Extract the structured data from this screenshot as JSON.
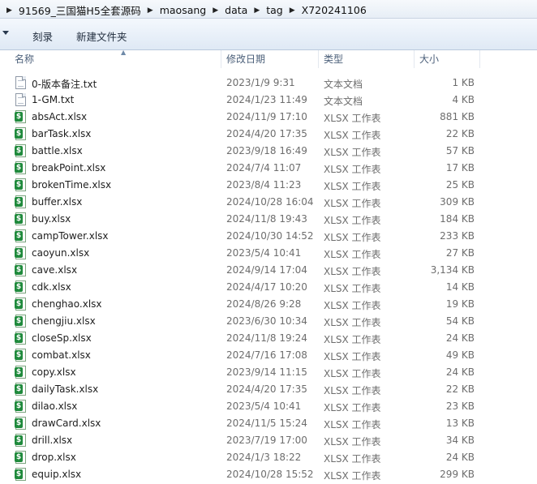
{
  "breadcrumb": [
    "91569_三国猫H5全套源码",
    "maosang",
    "data",
    "tag",
    "X720241106"
  ],
  "toolbar": {
    "burn": "刻录",
    "new_folder": "新建文件夹"
  },
  "columns": {
    "name": "名称",
    "date": "修改日期",
    "type": "类型",
    "size": "大小"
  },
  "files": [
    {
      "name": "0-版本备注.txt",
      "date": "2023/1/9 9:31",
      "type": "文本文档",
      "size": "1 KB",
      "icon": "txt"
    },
    {
      "name": "1-GM.txt",
      "date": "2024/1/23 11:49",
      "type": "文本文档",
      "size": "4 KB",
      "icon": "txt"
    },
    {
      "name": "absAct.xlsx",
      "date": "2024/11/9 17:10",
      "type": "XLSX 工作表",
      "size": "881 KB",
      "icon": "xlsx"
    },
    {
      "name": "barTask.xlsx",
      "date": "2024/4/20 17:35",
      "type": "XLSX 工作表",
      "size": "22 KB",
      "icon": "xlsx"
    },
    {
      "name": "battle.xlsx",
      "date": "2023/9/18 16:49",
      "type": "XLSX 工作表",
      "size": "57 KB",
      "icon": "xlsx"
    },
    {
      "name": "breakPoint.xlsx",
      "date": "2024/7/4 11:07",
      "type": "XLSX 工作表",
      "size": "17 KB",
      "icon": "xlsx"
    },
    {
      "name": "brokenTime.xlsx",
      "date": "2023/8/4 11:23",
      "type": "XLSX 工作表",
      "size": "25 KB",
      "icon": "xlsx"
    },
    {
      "name": "buffer.xlsx",
      "date": "2024/10/28 16:04",
      "type": "XLSX 工作表",
      "size": "309 KB",
      "icon": "xlsx"
    },
    {
      "name": "buy.xlsx",
      "date": "2024/11/8 19:43",
      "type": "XLSX 工作表",
      "size": "184 KB",
      "icon": "xlsx"
    },
    {
      "name": "campTower.xlsx",
      "date": "2024/10/30 14:52",
      "type": "XLSX 工作表",
      "size": "233 KB",
      "icon": "xlsx"
    },
    {
      "name": "caoyun.xlsx",
      "date": "2023/5/4 10:41",
      "type": "XLSX 工作表",
      "size": "27 KB",
      "icon": "xlsx"
    },
    {
      "name": "cave.xlsx",
      "date": "2024/9/14 17:04",
      "type": "XLSX 工作表",
      "size": "3,134 KB",
      "icon": "xlsx"
    },
    {
      "name": "cdk.xlsx",
      "date": "2024/4/17 10:20",
      "type": "XLSX 工作表",
      "size": "14 KB",
      "icon": "xlsx"
    },
    {
      "name": "chenghao.xlsx",
      "date": "2024/8/26 9:28",
      "type": "XLSX 工作表",
      "size": "19 KB",
      "icon": "xlsx"
    },
    {
      "name": "chengjiu.xlsx",
      "date": "2023/6/30 10:34",
      "type": "XLSX 工作表",
      "size": "54 KB",
      "icon": "xlsx"
    },
    {
      "name": "closeSp.xlsx",
      "date": "2024/11/8 19:24",
      "type": "XLSX 工作表",
      "size": "24 KB",
      "icon": "xlsx"
    },
    {
      "name": "combat.xlsx",
      "date": "2024/7/16 17:08",
      "type": "XLSX 工作表",
      "size": "49 KB",
      "icon": "xlsx"
    },
    {
      "name": "copy.xlsx",
      "date": "2023/9/14 11:15",
      "type": "XLSX 工作表",
      "size": "24 KB",
      "icon": "xlsx"
    },
    {
      "name": "dailyTask.xlsx",
      "date": "2024/4/20 17:35",
      "type": "XLSX 工作表",
      "size": "22 KB",
      "icon": "xlsx"
    },
    {
      "name": "dilao.xlsx",
      "date": "2023/5/4 10:41",
      "type": "XLSX 工作表",
      "size": "23 KB",
      "icon": "xlsx"
    },
    {
      "name": "drawCard.xlsx",
      "date": "2024/11/5 15:24",
      "type": "XLSX 工作表",
      "size": "13 KB",
      "icon": "xlsx"
    },
    {
      "name": "drill.xlsx",
      "date": "2023/7/19 17:00",
      "type": "XLSX 工作表",
      "size": "34 KB",
      "icon": "xlsx"
    },
    {
      "name": "drop.xlsx",
      "date": "2024/1/3 18:22",
      "type": "XLSX 工作表",
      "size": "24 KB",
      "icon": "xlsx"
    },
    {
      "name": "equip.xlsx",
      "date": "2024/10/28 15:52",
      "type": "XLSX 工作表",
      "size": "299 KB",
      "icon": "xlsx"
    }
  ]
}
